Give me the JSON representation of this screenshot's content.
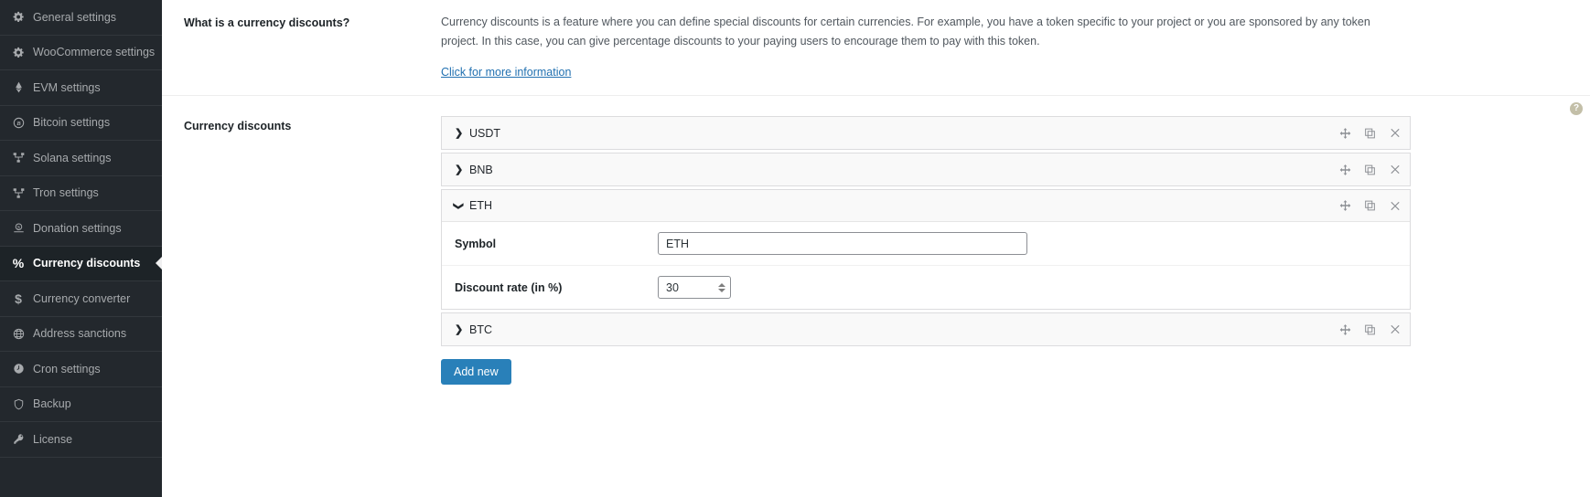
{
  "sidebar": {
    "items": [
      {
        "label": "General settings",
        "icon": "gear-icon",
        "active": false
      },
      {
        "label": "WooCommerce settings",
        "icon": "gear-icon",
        "active": false
      },
      {
        "label": "EVM settings",
        "icon": "ethereum-icon",
        "active": false
      },
      {
        "label": "Bitcoin settings",
        "icon": "bitcoin-icon",
        "active": false
      },
      {
        "label": "Solana settings",
        "icon": "network-icon",
        "active": false
      },
      {
        "label": "Tron settings",
        "icon": "network-icon",
        "active": false
      },
      {
        "label": "Donation settings",
        "icon": "donation-icon",
        "active": false
      },
      {
        "label": "Currency discounts",
        "icon": "percent-icon",
        "active": true
      },
      {
        "label": "Currency converter",
        "icon": "dollar-icon",
        "active": false
      },
      {
        "label": "Address sanctions",
        "icon": "globe-icon",
        "active": false
      },
      {
        "label": "Cron settings",
        "icon": "clock-icon",
        "active": false
      },
      {
        "label": "Backup",
        "icon": "shield-icon",
        "active": false
      },
      {
        "label": "License",
        "icon": "key-icon",
        "active": false
      }
    ]
  },
  "info_section": {
    "label": "What is a currency discounts?",
    "description": "Currency discounts is a feature where you can define special discounts for certain currencies. For example, you have a token specific to your project or you are sponsored by any token project. In this case, you can give percentage discounts to your paying users to encourage them to pay with this token.",
    "more_link": "Click for more information"
  },
  "discounts_section": {
    "label": "Currency discounts",
    "help_icon": "question-mark-icon",
    "add_button": "Add new",
    "row_tools": [
      "move-icon",
      "duplicate-icon",
      "close-icon"
    ],
    "groups": [
      {
        "title": "USDT",
        "expanded": false,
        "chevron": "chevron-right-icon"
      },
      {
        "title": "BNB",
        "expanded": false,
        "chevron": "chevron-right-icon"
      },
      {
        "title": "ETH",
        "expanded": true,
        "chevron": "chevron-down-icon",
        "fields": [
          {
            "label": "Symbol",
            "type": "text",
            "value": "ETH"
          },
          {
            "label": "Discount rate (in %)",
            "type": "number",
            "value": "30"
          }
        ]
      },
      {
        "title": "BTC",
        "expanded": false,
        "chevron": "chevron-right-icon"
      }
    ]
  },
  "colors": {
    "sidebar_bg": "#23282d",
    "sidebar_active_bg": "#1d2327",
    "accent_button": "#2980b9",
    "link": "#2271b1"
  }
}
